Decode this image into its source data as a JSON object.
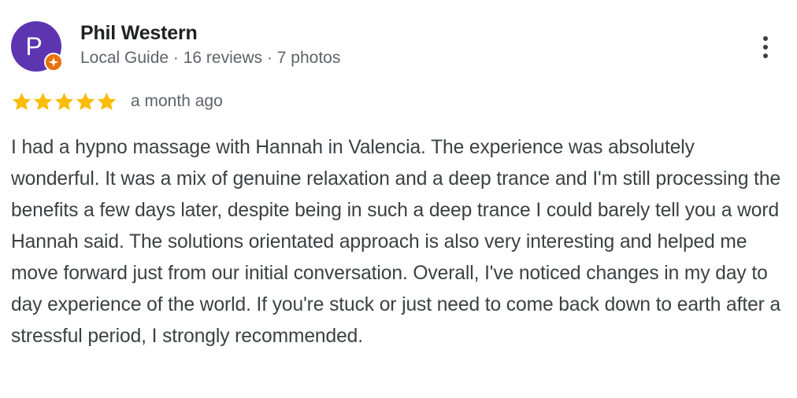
{
  "reviewer": {
    "initial": "P",
    "name": "Phil Western",
    "meta": "Local Guide · 16 reviews · 7 photos",
    "avatar_color": "#5e35b1",
    "badge_icon": "local-guide-star-icon",
    "badge_color": "#e8710a"
  },
  "rating": {
    "stars": 5,
    "max": 5,
    "star_color": "#fbbc04",
    "time": "a month ago"
  },
  "review": {
    "text": "I had a hypno massage with Hannah in Valencia. The experience was absolutely wonderful. It was a mix of genuine relaxation and a deep trance and I'm still processing the benefits a few days later, despite being in such a deep trance I could barely tell you a word Hannah said. The solutions orientated approach is also very interesting and helped me move forward just from our initial conversation. Overall, I've noticed changes in my day to day experience of the world. If you're stuck or just need to come back down to earth after a stressful period, I strongly recommended."
  },
  "actions": {
    "more_icon": "more-vertical-icon"
  }
}
